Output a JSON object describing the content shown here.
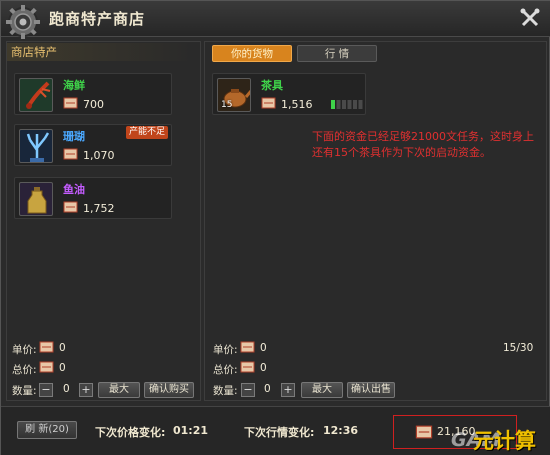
{
  "window": {
    "title": "跑商特产商店"
  },
  "left_panel": {
    "header": "商店特产",
    "items": [
      {
        "name": "海鲜",
        "name_color": "#3fd34a",
        "price": "700",
        "icon": "lobster-icon"
      },
      {
        "name": "珊瑚",
        "name_color": "#4aa8ff",
        "price": "1,070",
        "badge": "产能不足",
        "icon": "coral-icon"
      },
      {
        "name": "鱼油",
        "name_color": "#c45cff",
        "price": "1,752",
        "icon": "fish-oil-icon"
      }
    ],
    "unit_price_label": "单价:",
    "unit_price_value": "0",
    "total_price_label": "总价:",
    "total_price_value": "0",
    "quantity_label": "数量:",
    "quantity_value": "0",
    "max_label": "最大",
    "confirm_label": "确认购买"
  },
  "right_panel": {
    "tabs": [
      {
        "label": "你的货物",
        "active": true
      },
      {
        "label": "行 情",
        "active": false
      }
    ],
    "items": [
      {
        "name": "茶具",
        "name_color": "#3fd34a",
        "price": "1,516",
        "count": "15",
        "icon": "tea-set-icon",
        "bar_filled": 1,
        "bar_total": 6
      }
    ],
    "note": "下面的资金已经足够21000文任务，这时身上还有15个茶具作为下次的启动资金。",
    "unit_price_label": "单价:",
    "unit_price_value": "0",
    "capacity": "15/30",
    "total_price_label": "总价:",
    "total_price_value": "0",
    "quantity_label": "数量:",
    "quantity_value": "0",
    "max_label": "最大",
    "confirm_label": "确认出售"
  },
  "footer": {
    "refresh_label": "刷 新(20)",
    "price_change_label": "下次价格变化:",
    "price_change_time": "01:21",
    "market_change_label": "下次行情变化:",
    "market_change_time": "12:36",
    "money": "21,160",
    "watermark_a": "GAM",
    "watermark_b": "元计算"
  },
  "colors": {
    "accent": "#d8841e",
    "note": "#e03030",
    "highlight_box": "#d02020"
  }
}
